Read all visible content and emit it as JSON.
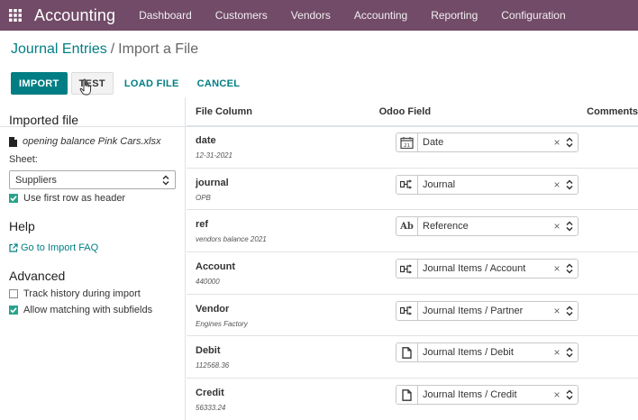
{
  "navbar": {
    "brand": "Accounting",
    "items": [
      "Dashboard",
      "Customers",
      "Vendors",
      "Accounting",
      "Reporting",
      "Configuration"
    ],
    "color": "#714b67"
  },
  "breadcrumb": {
    "parent": "Journal Entries",
    "separator": "/",
    "current": "Import a File"
  },
  "buttons": {
    "import": "IMPORT",
    "test": "TEST",
    "load_file": "LOAD FILE",
    "cancel": "CANCEL"
  },
  "sidebar": {
    "imported_title": "Imported file",
    "file_name": "opening balance Pink Cars.xlsx",
    "sheet_label": "Sheet:",
    "sheet_value": "Suppliers",
    "header_check": {
      "label": "Use first row as header",
      "checked": true
    },
    "help_title": "Help",
    "faq_link": "Go to Import FAQ",
    "advanced_title": "Advanced",
    "track_history": {
      "label": "Track history during import",
      "checked": false
    },
    "allow_matching": {
      "label": "Allow matching with subfields",
      "checked": true
    }
  },
  "table": {
    "headers": {
      "file_column": "File Column",
      "odoo_field": "Odoo Field",
      "comments": "Comments"
    },
    "rows": [
      {
        "name": "date",
        "sample": "12-31-2021",
        "field": "Date",
        "icon": "calendar-icon"
      },
      {
        "name": "journal",
        "sample": "OPB",
        "field": "Journal",
        "icon": "relation-icon"
      },
      {
        "name": "ref",
        "sample": "vendors balance 2021",
        "field": "Reference",
        "icon": "text-field-icon"
      },
      {
        "name": "Account",
        "sample": "440000",
        "field": "Journal Items / Account",
        "icon": "relation-icon"
      },
      {
        "name": "Vendor",
        "sample": "Engines Factory",
        "field": "Journal Items / Partner",
        "icon": "relation-icon"
      },
      {
        "name": "Debit",
        "sample": "112568.36",
        "field": "Journal Items / Debit",
        "icon": "document-icon"
      },
      {
        "name": "Credit",
        "sample": "56333.24",
        "field": "Journal Items / Credit",
        "icon": "document-icon"
      }
    ]
  },
  "colors": {
    "accent": "#017e84",
    "check": "#2aa28c"
  }
}
